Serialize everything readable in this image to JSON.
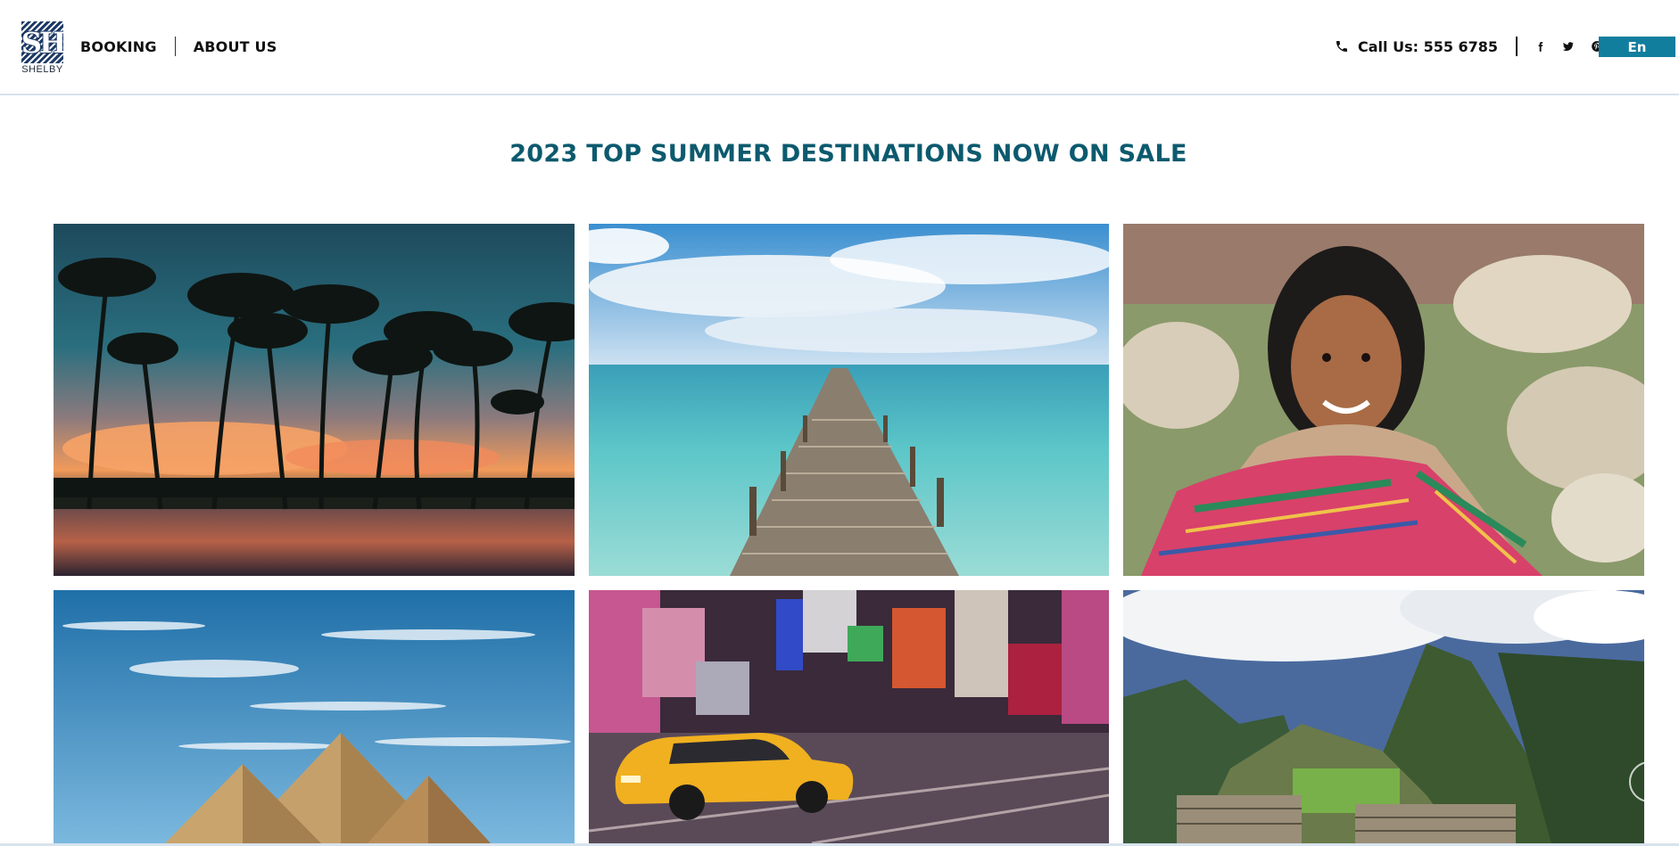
{
  "brand": {
    "name": "SHELBY",
    "monogram": "SH"
  },
  "nav": {
    "booking": "BOOKING",
    "about": "ABOUT US"
  },
  "contact": {
    "call_label": "Call Us: 555 6785"
  },
  "social": [
    "facebook-icon",
    "twitter-icon",
    "pinterest-icon"
  ],
  "language": {
    "current": "En"
  },
  "section": {
    "title": "2023 TOP SUMMER DESTINATIONS NOW ON SALE"
  },
  "destinations": [
    {
      "scene": "tropical beach sunset with palm trees"
    },
    {
      "scene": "wooden pier over turquoise sea"
    },
    {
      "scene": "smiling girl in colorful Andean shawl"
    },
    {
      "scene": "pyramids of Giza under blue sky"
    },
    {
      "scene": "yellow taxi in Times Square at night"
    },
    {
      "scene": "Machu Picchu mountain ruins"
    }
  ],
  "colors": {
    "accent": "#127e9e",
    "title": "#0c5a6e",
    "logo": "#1e3a66"
  }
}
